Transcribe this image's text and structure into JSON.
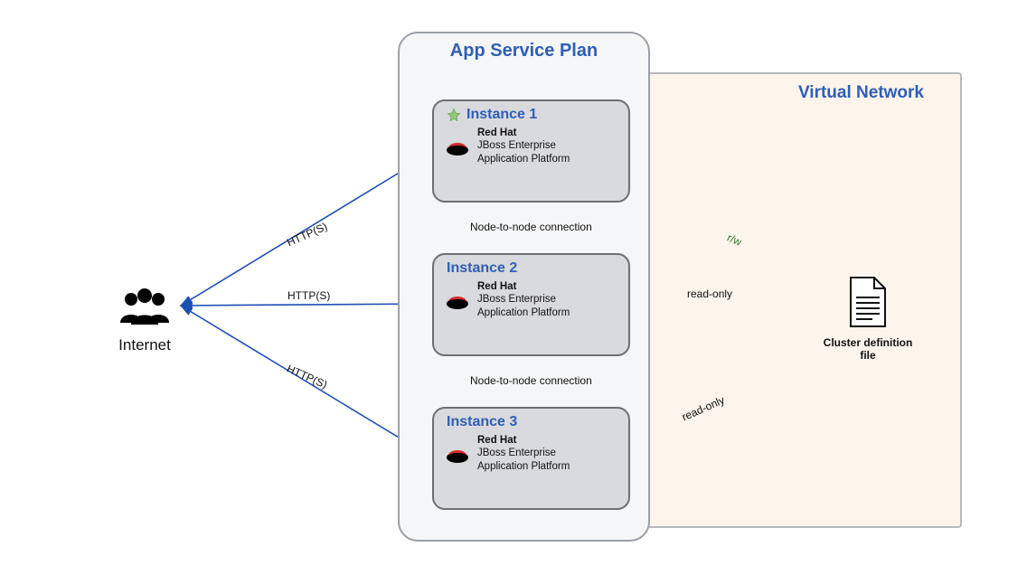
{
  "diagram": {
    "internet_label": "Internet",
    "app_service_plan_title": "App Service Plan",
    "virtual_network_title": "Virtual Network",
    "cluster_file_label": "Cluster definition file",
    "instance_product": {
      "vendor": "Red Hat",
      "line1": "JBoss Enterprise",
      "line2": "Application Platform"
    },
    "instances": [
      {
        "title": "Instance 1",
        "starred": true
      },
      {
        "title": "Instance 2",
        "starred": false
      },
      {
        "title": "Instance 3",
        "starred": false
      }
    ],
    "edge_labels": {
      "https": "HTTP(S)",
      "node_to_node": "Node-to-node connection",
      "rw": "r/w",
      "read_only": "read-only"
    }
  }
}
